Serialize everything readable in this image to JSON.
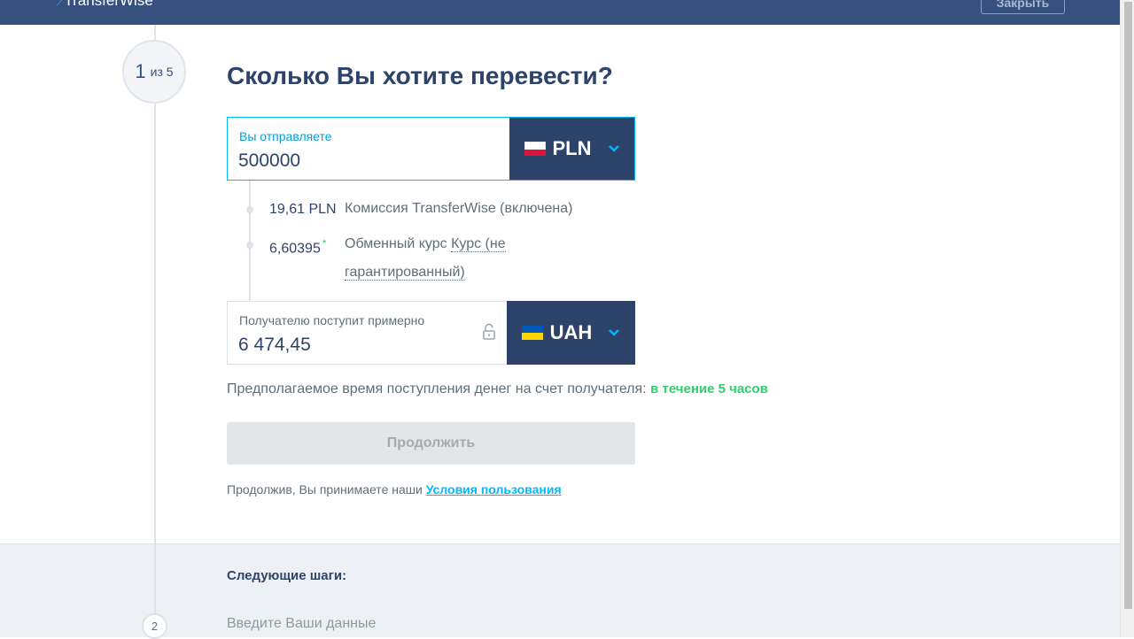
{
  "header": {
    "logo_text": "TransferWise",
    "close_label": "Закрыть",
    "bg_color": "#37517e"
  },
  "stepper": {
    "current": "1",
    "of_label": "из 5",
    "next_step_number": "2"
  },
  "page_title": "Сколько Вы хотите перевести?",
  "send": {
    "label": "Вы отправляете",
    "amount": "500000",
    "currency": "PLN",
    "flag": "poland-flag-icon"
  },
  "breakdown": {
    "fee_amount": "19,61 PLN",
    "fee_label": "Комиссия TransferWise (включена)",
    "rate_amount": "6,60395",
    "rate_mark": "*",
    "rate_label_prefix": "Обменный курс",
    "rate_label_link_line1": "Курс (не",
    "rate_label_link_line2": "гарантированный)"
  },
  "receive": {
    "label": "Получателю поступит примерно",
    "amount": "6 474,45",
    "currency": "UAH",
    "flag": "ukraine-flag-icon"
  },
  "eta": {
    "prefix": "Предполагаемое время поступления денег на счет получателя:",
    "value": "в течение 5 часов"
  },
  "continue_label": "Продолжить",
  "terms": {
    "prefix": "Продолжив, Вы принимаете наши",
    "link": "Условия пользования"
  },
  "next_steps": {
    "title": "Следующие шаги:",
    "step2": "Введите Ваши данные"
  },
  "colors": {
    "accent": "#00b9ff",
    "navy": "#2e4369",
    "success": "#2ed06e"
  }
}
